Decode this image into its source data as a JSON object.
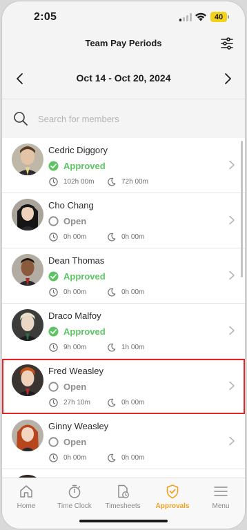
{
  "status_bar": {
    "time": "2:05",
    "battery": "40"
  },
  "header": {
    "title": "Team Pay Periods"
  },
  "period": {
    "label": "Oct 14 - Oct 20, 2024"
  },
  "search": {
    "placeholder": "Search for members"
  },
  "members": [
    {
      "name": "Cedric Diggory",
      "status": "Approved",
      "work": "102h 00m",
      "break": "72h 00m"
    },
    {
      "name": "Cho Chang",
      "status": "Open",
      "work": "0h 00m",
      "break": "0h 00m"
    },
    {
      "name": "Dean Thomas",
      "status": "Approved",
      "work": "0h 00m",
      "break": "0h 00m"
    },
    {
      "name": "Draco Malfoy",
      "status": "Approved",
      "work": "9h 00m",
      "break": "1h 00m"
    },
    {
      "name": "Fred Weasley",
      "status": "Open",
      "work": "27h 10m",
      "break": "0h 00m"
    },
    {
      "name": "Ginny Weasley",
      "status": "Open",
      "work": "0h 00m",
      "break": "0h 00m"
    }
  ],
  "tabs": [
    {
      "label": "Home",
      "icon": "home-icon"
    },
    {
      "label": "Time Clock",
      "icon": "stopwatch-icon"
    },
    {
      "label": "Timesheets",
      "icon": "timesheet-icon"
    },
    {
      "label": "Approvals",
      "icon": "shield-check-icon"
    },
    {
      "label": "Menu",
      "icon": "hamburger-icon"
    }
  ],
  "colors": {
    "approved": "#5cc463",
    "open": "#8d8d8d",
    "active_tab": "#f0a020",
    "highlight": "#e02727"
  }
}
